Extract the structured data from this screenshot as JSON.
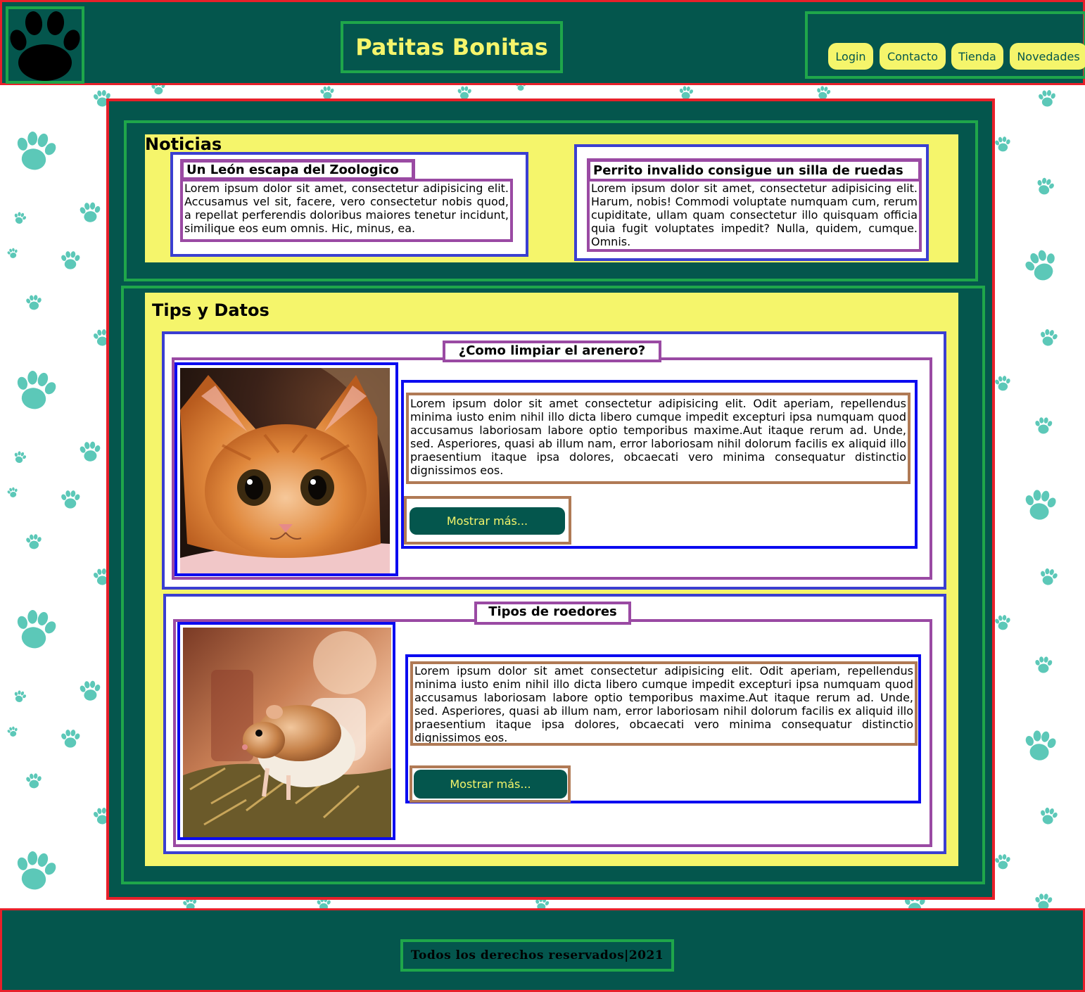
{
  "header": {
    "logo_icon": "paw-icon",
    "title": "Patitas Bonitas",
    "nav": [
      {
        "label": "Login"
      },
      {
        "label": "Contacto"
      },
      {
        "label": "Tienda"
      },
      {
        "label": "Novedades"
      }
    ]
  },
  "noticias": {
    "heading": "Noticias",
    "items": [
      {
        "title": "Un León escapa del Zoologico",
        "text": "Lorem ipsum dolor sit amet, consectetur adipisicing elit. Accusamus vel sit, facere, vero consectetur nobis quod, a repellat perferendis doloribus maiores tenetur incidunt, similique eos eum omnis. Hic, minus, ea."
      },
      {
        "title": "Perrito invalido consigue un silla de ruedas",
        "text": "Lorem ipsum dolor sit amet, consectetur adipisicing elit. Harum, nobis! Commodi voluptate numquam cum, rerum cupiditate, ullam quam consectetur illo quisquam officia quia fugit voluptates impedit? Nulla, quidem, cumque. Omnis."
      }
    ]
  },
  "tips": {
    "heading": "Tips y Datos",
    "items": [
      {
        "title": "¿Como limpiar el arenero?",
        "image": "orange-cat-photo",
        "text": "Lorem ipsum dolor sit amet consectetur adipisicing elit. Odit aperiam, repellendus minima iusto enim nihil illo dicta libero cumque impedit excepturi ipsa numquam quod accusamus laboriosam labore optio temporibus maxime.Aut itaque rerum ad. Unde, sed. Asperiores, quasi ab illum nam, error laboriosam nihil dolorum facilis ex aliquid illo praesentium itaque ipsa dolores, obcaecati vero minima consequatur distinctio dignissimos eos.",
        "button": "Mostrar más..."
      },
      {
        "title": "Tipos de roedores",
        "image": "hamster-photo",
        "text": "Lorem ipsum dolor sit amet consectetur adipisicing elit. Odit aperiam, repellendus minima iusto enim nihil illo dicta libero cumque impedit excepturi ipsa numquam quod accusamus laboriosam labore optio temporibus maxime.Aut itaque rerum ad. Unde, sed. Asperiores, quasi ab illum nam, error laboriosam nihil dolorum facilis ex aliquid illo praesentium itaque ipsa dolores, obcaecati vero minima consequatur distinctio dignissimos eos.",
        "button": "Mostrar más..."
      }
    ]
  },
  "footer": {
    "text": "Todos los derechos reservados|2021"
  },
  "colors": {
    "brand_green": "#04564d",
    "accent_yellow": "#f5f56b",
    "paw_teal": "#5cc8b8"
  }
}
